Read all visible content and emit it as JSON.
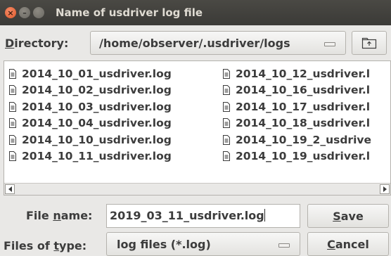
{
  "window": {
    "title": "Name of usdriver log file",
    "controls": {
      "close_glyph": "×",
      "minimize_glyph": "–",
      "maximize_glyph": ""
    }
  },
  "directory": {
    "label_mnemonic": "D",
    "label_rest": "irectory:",
    "value": "/home/observer/.usdriver/logs",
    "up_icon": "folder-up-icon"
  },
  "file_list": {
    "column1": [
      "2014_10_01_usdriver.log",
      "2014_10_02_usdriver.log",
      "2014_10_03_usdriver.log",
      "2014_10_04_usdriver.log",
      "2014_10_10_usdriver.log",
      "2014_10_11_usdriver.log"
    ],
    "column2": [
      "2014_10_12_usdriver.l",
      "2014_10_16_usdriver.l",
      "2014_10_17_usdriver.l",
      "2014_10_18_usdriver.l",
      "2014_10_19_2_usdrive",
      "2014_10_19_usdriver.l"
    ],
    "file_icon": "file-icon"
  },
  "file_name": {
    "label_before": "File ",
    "label_mnemonic": "n",
    "label_after": "ame:",
    "value": "2019_03_11_usdriver.log"
  },
  "file_type": {
    "label_before": "Files of ",
    "label_mnemonic": "t",
    "label_after": "ype:",
    "value": "log files (*.log)"
  },
  "buttons": {
    "save_mnemonic": "S",
    "save_rest": "ave",
    "cancel_mnemonic": "C",
    "cancel_rest": "ancel"
  },
  "colors": {
    "titlebar": "#3c3b37",
    "close_button": "#e95420",
    "dialog_bg": "#e9e8e6",
    "text": "#3c3c3c"
  }
}
